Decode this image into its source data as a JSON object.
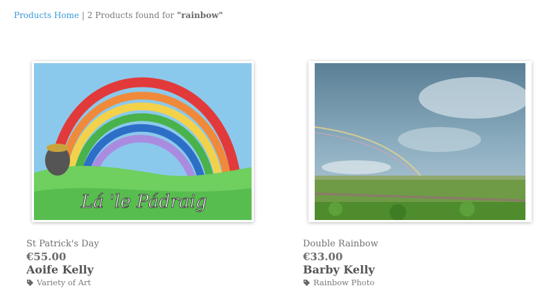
{
  "breadcrumb": {
    "home": "Products Home",
    "separator": "|",
    "count_text": "2 Products found for",
    "query": "\"rainbow\""
  },
  "products": [
    {
      "title": "St Patrick's Day",
      "price": "€55.00",
      "artist": "Aoife Kelly",
      "category": "Variety of Art",
      "image_text": "Lá 'le Pádraig",
      "icon": "tag-icon"
    },
    {
      "title": "Double Rainbow",
      "price": "€33.00",
      "artist": "Barby Kelly",
      "category": "Rainbow Photo",
      "icon": "tag-icon"
    }
  ],
  "colors": {
    "link": "#3a9bd9",
    "text": "#6b6b6b"
  }
}
